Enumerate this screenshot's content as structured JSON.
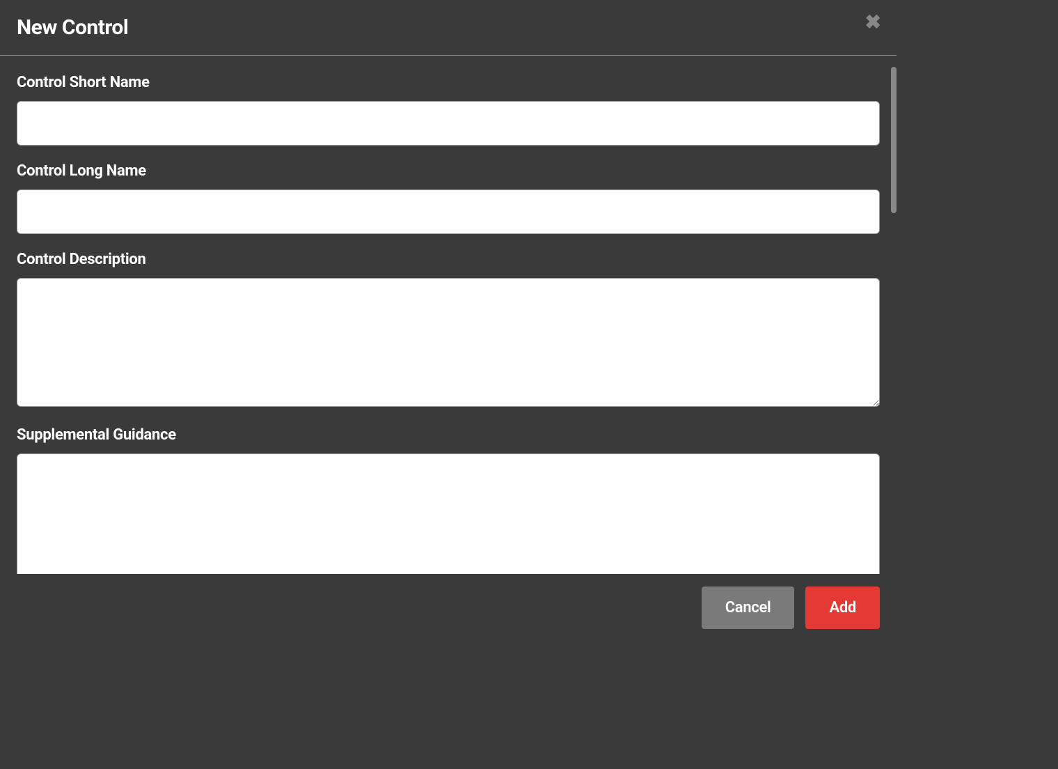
{
  "modal": {
    "title": "New Control",
    "fields": {
      "short_name": {
        "label": "Control Short Name",
        "value": ""
      },
      "long_name": {
        "label": "Control Long Name",
        "value": ""
      },
      "description": {
        "label": "Control Description",
        "value": ""
      },
      "supplemental": {
        "label": "Supplemental Guidance",
        "value": ""
      }
    },
    "buttons": {
      "cancel": "Cancel",
      "add": "Add"
    }
  }
}
